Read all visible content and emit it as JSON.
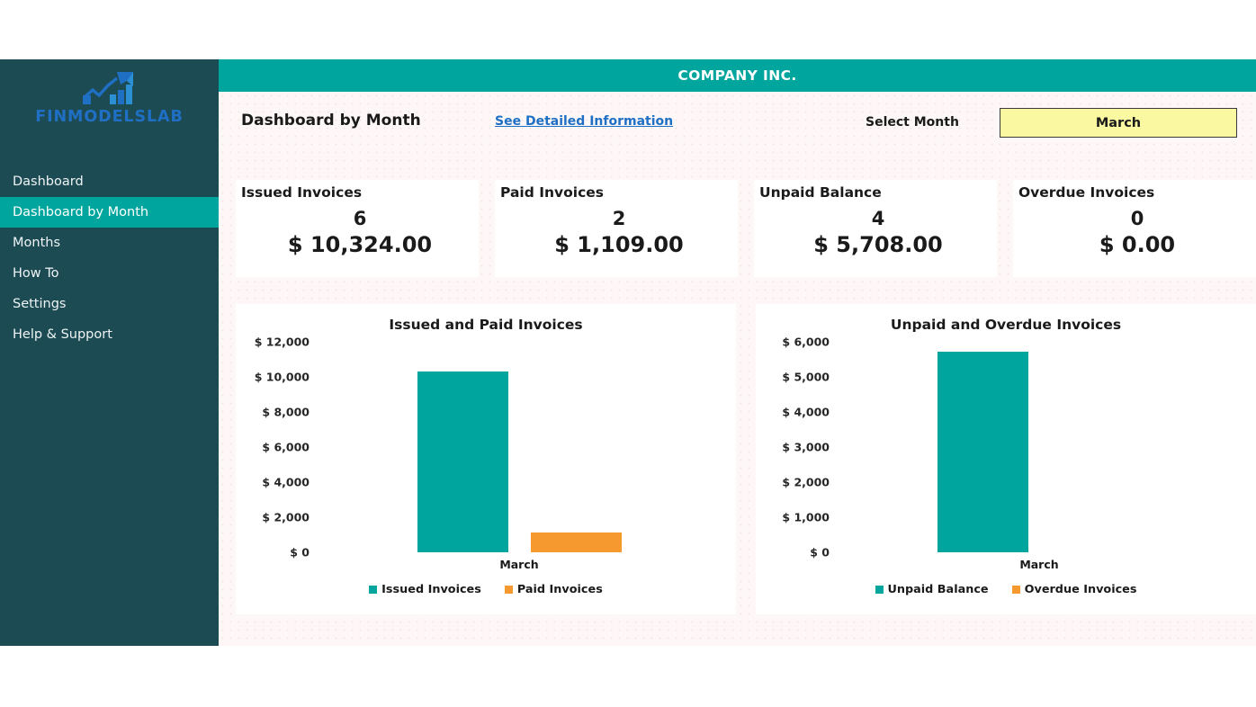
{
  "sidebar": {
    "logo_text": "FINMODELSLAB",
    "logo_icon": "bar-chart-arrow-logo",
    "items": [
      {
        "label": "Dashboard",
        "active": false
      },
      {
        "label": "Dashboard by Month",
        "active": true
      },
      {
        "label": "Months",
        "active": false
      },
      {
        "label": "How To",
        "active": false
      },
      {
        "label": "Settings",
        "active": false
      },
      {
        "label": "Help & Support",
        "active": false
      }
    ]
  },
  "header": {
    "company_title": "COMPANY INC."
  },
  "toolbar": {
    "page_title": "Dashboard by Month",
    "detail_link": "See Detailed Information",
    "select_month_label": "Select Month",
    "selected_month": "March"
  },
  "kpis": [
    {
      "label": "Issued Invoices",
      "count": "6",
      "amount": "$ 10,324.00"
    },
    {
      "label": "Paid Invoices",
      "count": "2",
      "amount": "$ 1,109.00"
    },
    {
      "label": "Unpaid Balance",
      "count": "4",
      "amount": "$ 5,708.00"
    },
    {
      "label": "Overdue Invoices",
      "count": "0",
      "amount": "$ 0.00"
    }
  ],
  "colors": {
    "teal": "#00a59e",
    "orange": "#f6992e",
    "sidebar": "#1d4b54",
    "link": "#1f6fc4",
    "select_bg": "#faf8a0",
    "panel_bg": "#ffffff",
    "page_bg": "#fdf8f7"
  },
  "chart_data": [
    {
      "type": "bar",
      "title": "Issued and Paid Invoices",
      "categories": [
        "March"
      ],
      "xlabel": "March",
      "ylabel": "",
      "ylim": [
        0,
        12000
      ],
      "ytick_labels": [
        "$ 12,000",
        "$ 10,000",
        "$ 8,000",
        "$ 6,000",
        "$ 4,000",
        "$ 2,000",
        "$ 0"
      ],
      "ytick_values": [
        12000,
        10000,
        8000,
        6000,
        4000,
        2000,
        0
      ],
      "grid": false,
      "legend_position": "bottom",
      "series": [
        {
          "name": "Issued Invoices",
          "color": "#00a59e",
          "values": [
            10324
          ]
        },
        {
          "name": "Paid Invoices",
          "color": "#f6992e",
          "values": [
            1109
          ]
        }
      ]
    },
    {
      "type": "bar",
      "title": "Unpaid and Overdue Invoices",
      "categories": [
        "March"
      ],
      "xlabel": "March",
      "ylabel": "",
      "ylim": [
        0,
        6000
      ],
      "ytick_labels": [
        "$ 6,000",
        "$ 5,000",
        "$ 4,000",
        "$ 3,000",
        "$ 2,000",
        "$ 1,000",
        "$ 0"
      ],
      "ytick_values": [
        6000,
        5000,
        4000,
        3000,
        2000,
        1000,
        0
      ],
      "grid": false,
      "legend_position": "bottom",
      "series": [
        {
          "name": "Unpaid Balance",
          "color": "#00a59e",
          "values": [
            5708
          ]
        },
        {
          "name": "Overdue Invoices",
          "color": "#f6992e",
          "values": [
            0
          ]
        }
      ]
    }
  ]
}
